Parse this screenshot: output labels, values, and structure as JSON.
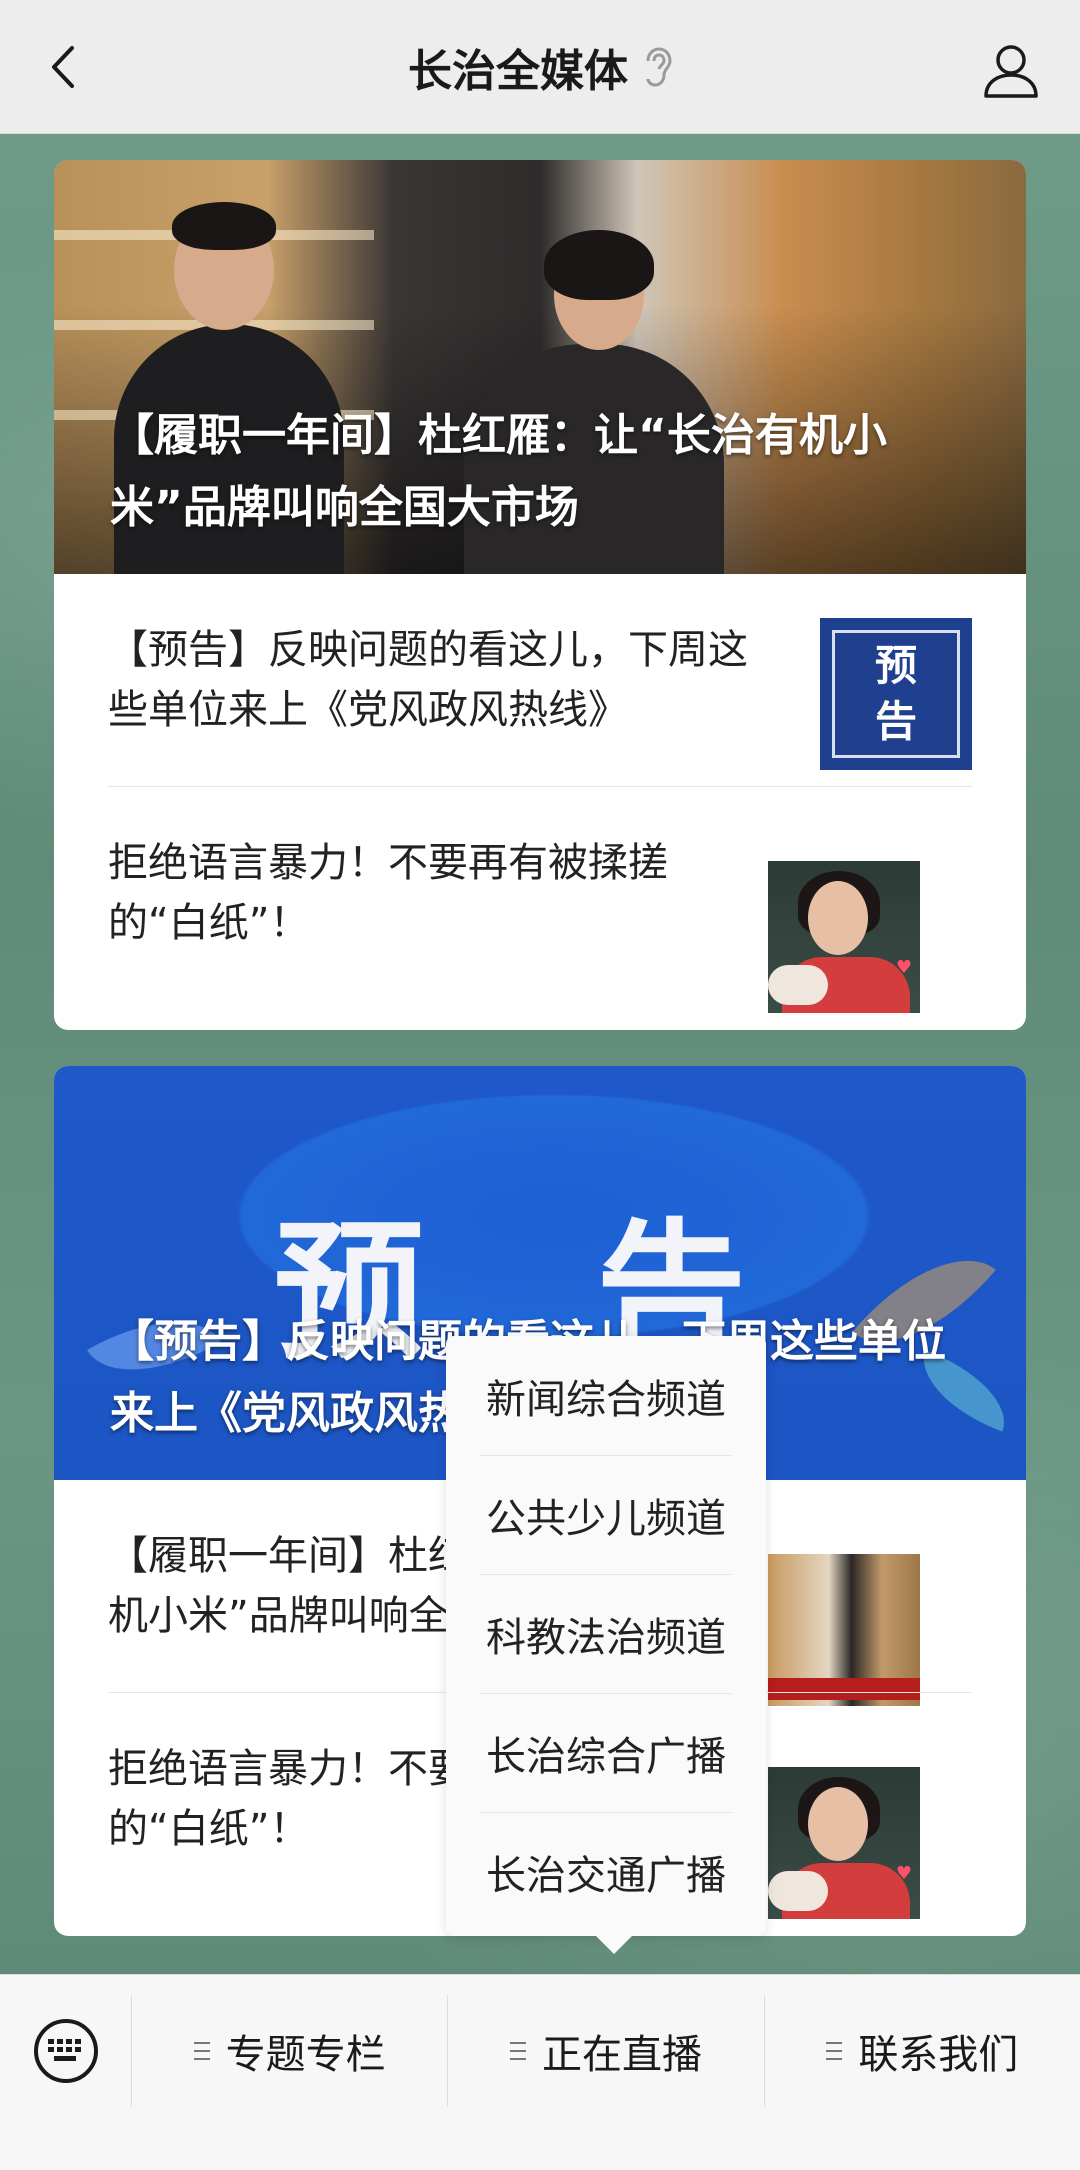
{
  "header": {
    "title": "长治全媒体"
  },
  "cards": [
    {
      "hero_title": "【履职一年间】杜红雁：让“长治有机小米”品牌叫响全国大市场",
      "items": [
        {
          "text": "【预告】反映问题的看这儿，下周这些单位来上《党风政风热线》",
          "thumb": "yugao",
          "thumb_text": [
            "预",
            "告"
          ]
        },
        {
          "text": "拒绝语言暴力！不要再有被揉搓的“白纸”！",
          "thumb": "girl"
        }
      ]
    },
    {
      "hero_big_text": "预 告",
      "hero_title": "【预告】反映问题的看这儿，下周这些单位来上《党风政风热线》",
      "items": [
        {
          "text": "【履职一年间】杜红雁：让“长治有机小米”品牌叫响全国大市场",
          "thumb": "store"
        },
        {
          "text": "拒绝语言暴力！不要再有被揉搓的“白纸”！",
          "thumb": "girl"
        }
      ]
    }
  ],
  "popup_menu": {
    "items": [
      "新闻综合频道",
      "公共少儿频道",
      "科教法治频道",
      "长治综合广播",
      "长治交通广播"
    ]
  },
  "bottom_bar": {
    "menus": [
      "专题专栏",
      "正在直播",
      "联系我们"
    ]
  }
}
